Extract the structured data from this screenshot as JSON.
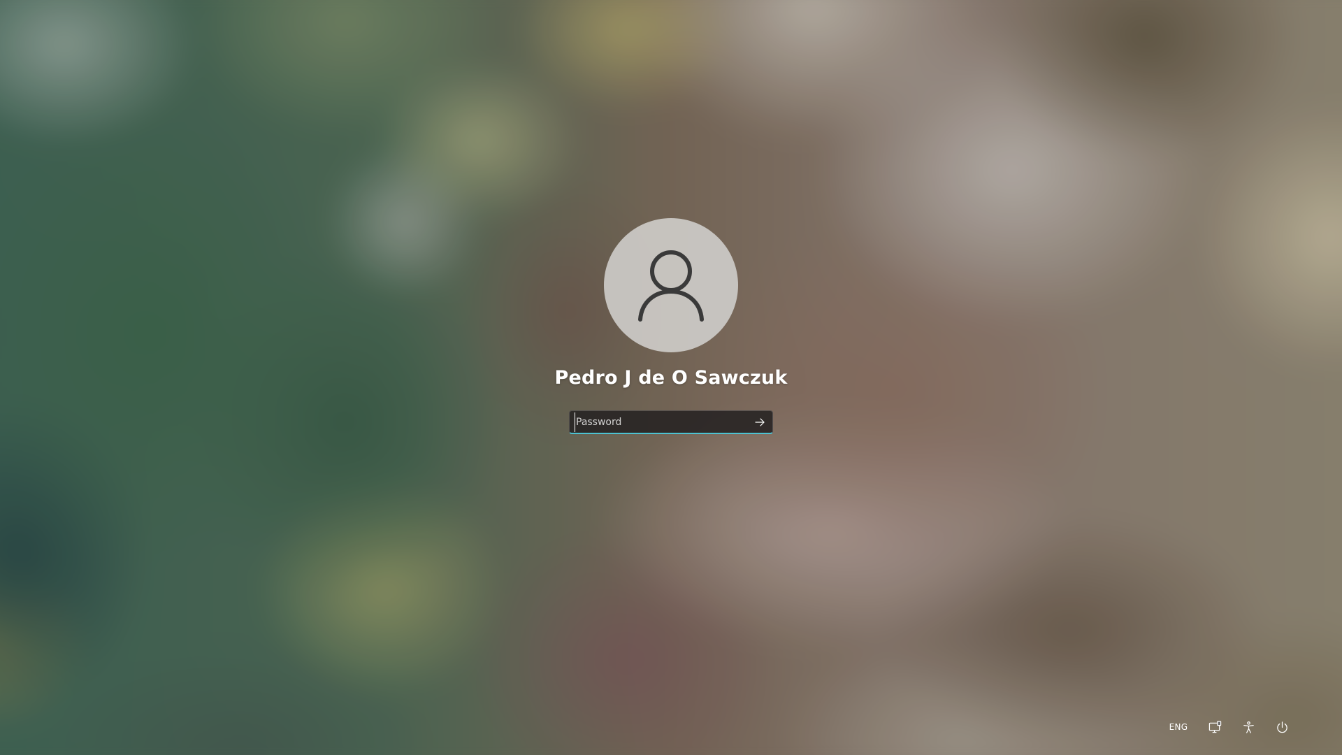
{
  "user": {
    "name": "Pedro J de O Sawczuk",
    "avatar_icon": "user-icon"
  },
  "password": {
    "placeholder": "Password",
    "value": "",
    "submit_icon": "arrow-right-icon"
  },
  "tray": {
    "language": "ENG",
    "network_icon": "network-icon",
    "accessibility_icon": "accessibility-icon",
    "power_icon": "power-icon"
  },
  "colors": {
    "focus_accent": "#4cc2d1",
    "avatar_bg": "#cdcbc8",
    "input_bg": "#262222"
  }
}
